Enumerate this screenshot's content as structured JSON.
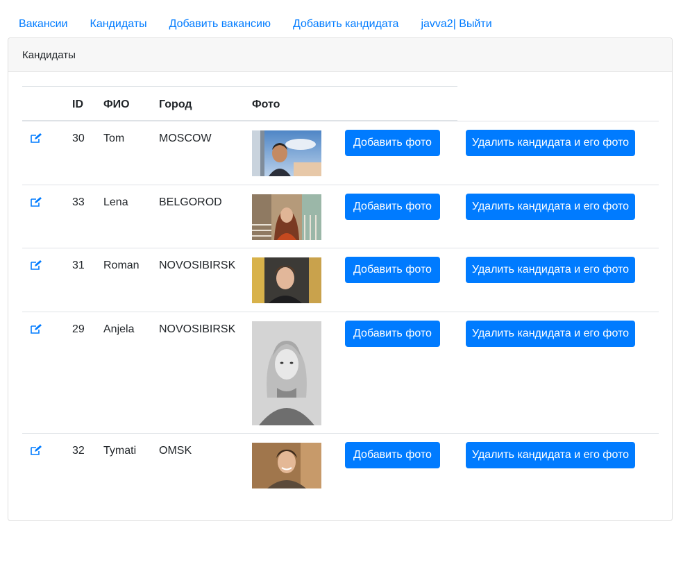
{
  "nav": {
    "vacancies": "Вакансии",
    "candidates": "Кандидаты",
    "add_vacancy": "Добавить вакансию",
    "add_candidate": "Добавить кандидата",
    "logout": "javva2| Выйти"
  },
  "card": {
    "title": "Кандидаты"
  },
  "table": {
    "headers": {
      "id": "ID",
      "name": "ФИО",
      "city": "Город",
      "photo": "Фото"
    },
    "add_photo_label": "Добавить фото",
    "delete_label": "Удалить кандидата и его фото",
    "rows": [
      {
        "id": "30",
        "name": "Tom",
        "city": "MOSCOW"
      },
      {
        "id": "33",
        "name": "Lena",
        "city": "BELGOROD"
      },
      {
        "id": "31",
        "name": "Roman",
        "city": "NOVOSIBIRSK"
      },
      {
        "id": "29",
        "name": "Anjela",
        "city": "NOVOSIBIRSK"
      },
      {
        "id": "32",
        "name": "Tymati",
        "city": "OMSK"
      }
    ]
  },
  "colors": {
    "accent": "#007bff",
    "header_bg": "#f7f7f7",
    "border": "#dee2e6"
  }
}
